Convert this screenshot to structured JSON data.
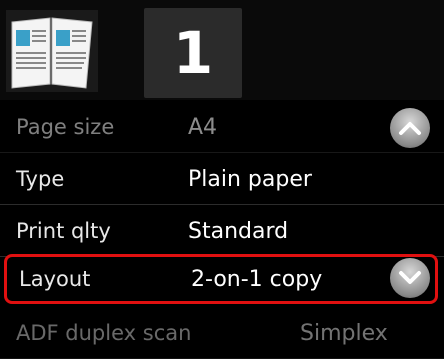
{
  "header": {
    "copy_count": "1",
    "thumbnail_icon": "two-on-one-copy-thumbnail-icon"
  },
  "settings": {
    "page_size": {
      "label": "Page size",
      "value": "A4"
    },
    "type": {
      "label": "Type",
      "value": "Plain paper"
    },
    "print_quality": {
      "label": "Print qlty",
      "value": "Standard"
    },
    "layout": {
      "label": "Layout",
      "value": "2-on-1 copy"
    },
    "adf_duplex": {
      "label": "ADF duplex scan",
      "value": "Simplex"
    }
  },
  "controls": {
    "scroll_up_icon": "chevron-up-icon",
    "scroll_down_icon": "chevron-down-icon"
  },
  "colors": {
    "highlight": "#e01010",
    "background": "#000000"
  }
}
